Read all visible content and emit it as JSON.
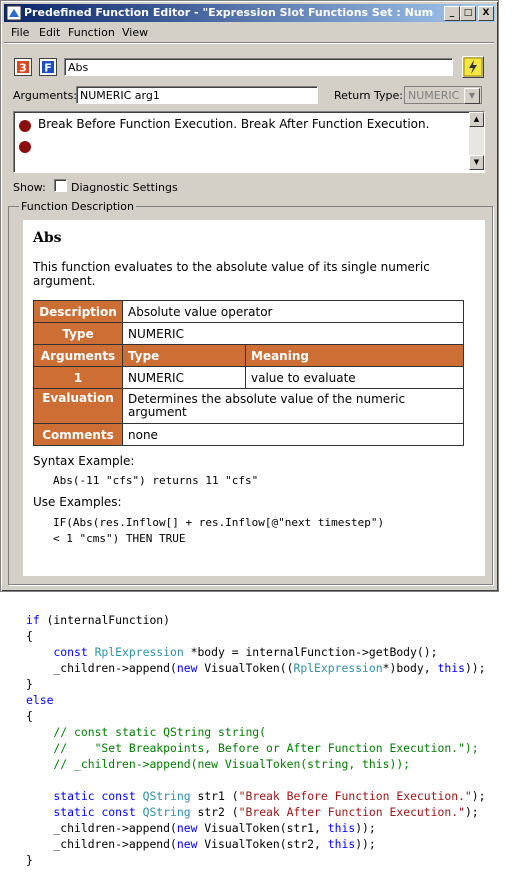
{
  "window": {
    "title": "Predefined Function Editor - \"Expression Slot Functions Set : Numeric / ...",
    "controls": [
      "_",
      "□",
      "X"
    ]
  },
  "menu": [
    "File",
    "Edit",
    "Function",
    "View"
  ],
  "toolbar": {
    "function_name": "Abs"
  },
  "arguments": {
    "label": "Arguments:",
    "value": "NUMERIC arg1"
  },
  "return_type": {
    "label": "Return Type:",
    "value": "NUMERIC"
  },
  "breakpoints_text": "Break Before Function Execution. Break After Function Execution.",
  "show": {
    "label": "Show:",
    "checkbox_label": "Diagnostic Settings",
    "checked": false
  },
  "description_group": "Function Description",
  "description": {
    "heading": "Abs",
    "text": "This function evaluates to the absolute value of its single numeric argument.",
    "table": {
      "description_label": "Description",
      "description_value": "Absolute value operator",
      "type_label": "Type",
      "type_value": "NUMERIC",
      "arguments_label": "Arguments",
      "col_type": "Type",
      "col_meaning": "Meaning",
      "arg_num": "1",
      "arg_type": "NUMERIC",
      "arg_meaning": "value to evaluate",
      "evaluation_label": "Evaluation",
      "evaluation_value": "Determines the absolute value of the numeric argument",
      "comments_label": "Comments",
      "comments_value": "none"
    },
    "syntax_label": "Syntax Example:",
    "syntax_code": "Abs(-11 \"cfs\") returns 11 \"cfs\"",
    "use_label": "Use Examples:",
    "use_code_1": "IF(Abs(res.Inflow[] + res.Inflow[@\"next timestep\")",
    "use_code_2": "< 1 \"cms\") THEN TRUE"
  },
  "code": {
    "l1_kw": "if",
    "l1_rest": " (internalFunction)",
    "l2": "{",
    "l3_kw": "    const ",
    "l3_ty": "RplExpression",
    "l3_rest": " *body = internalFunction->getBody();",
    "l4_a": "    _children->append(",
    "l4_kw": "new",
    "l4_b": " VisualToken((",
    "l4_ty": "RplExpression",
    "l4_c": "*)body, ",
    "l4_kw2": "this",
    "l4_d": "));",
    "l5": "}",
    "l6": "else",
    "l7": "{",
    "l8": "    // const static QString string(",
    "l9": "    //    \"Set Breakpoints, Before or After Function Execution.\");",
    "l10": "    // _children->append(new VisualToken(string, this));",
    "l12_kw": "    static const ",
    "l12_ty": "QString",
    "l12_a": " str1 (",
    "l12_str": "\"Break Before Function Execution.\"",
    "l12_b": ");",
    "l13_kw": "    static const ",
    "l13_ty": "QString",
    "l13_a": " str2 (",
    "l13_str": "\"Break After Function Execution.\"",
    "l13_b": ");",
    "l14_a": "    _children->append(",
    "l14_kw": "new",
    "l14_b": " VisualToken(str1, ",
    "l14_kw2": "this",
    "l14_c": "));",
    "l15_a": "    _children->append(",
    "l15_kw": "new",
    "l15_b": " VisualToken(str2, ",
    "l15_kw2": "this",
    "l15_c": "));",
    "l16": "}"
  }
}
